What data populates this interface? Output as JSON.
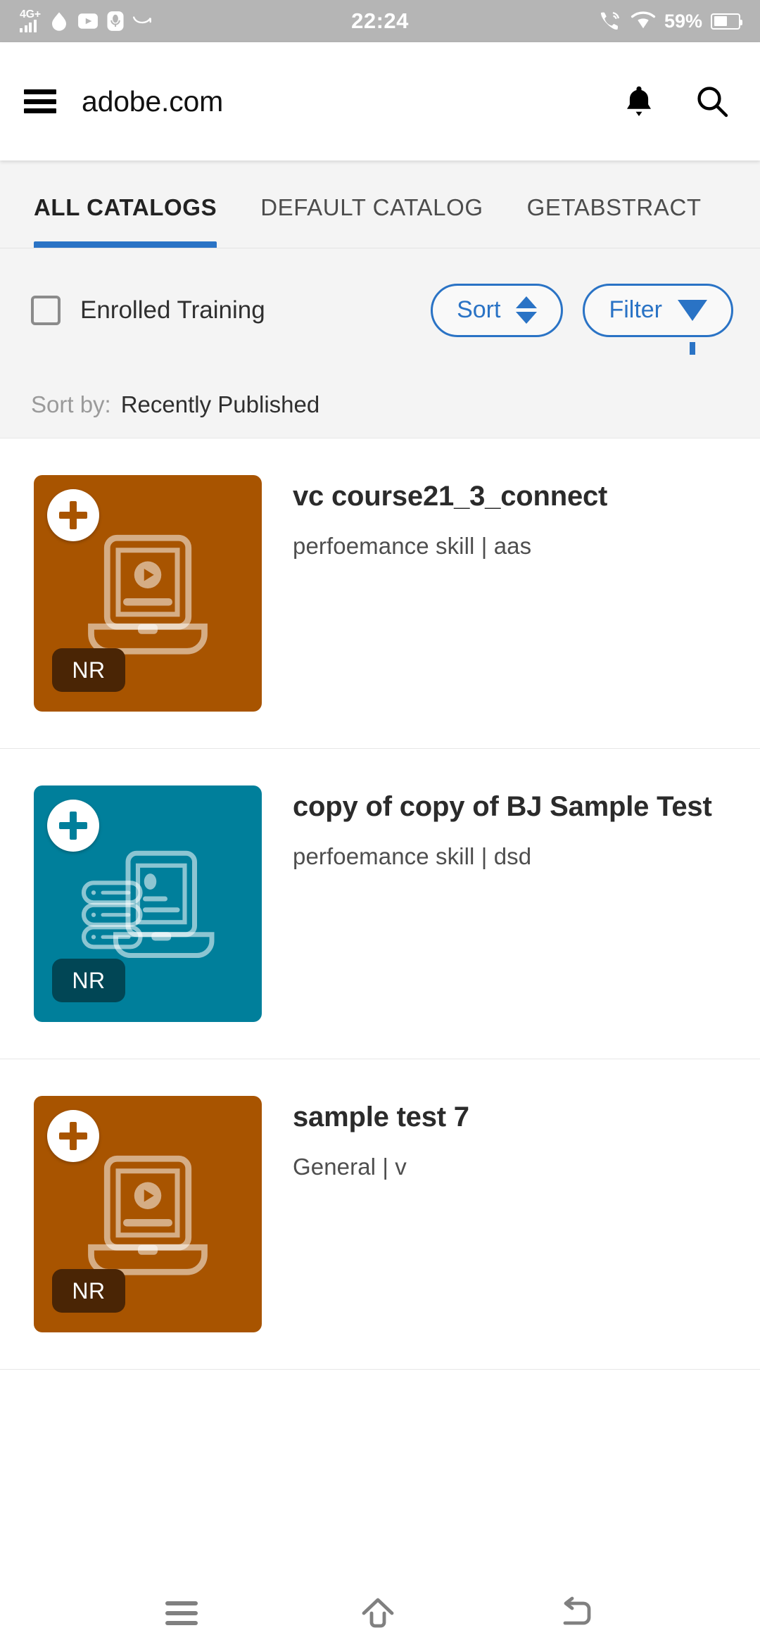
{
  "statusbar": {
    "network_label": "4G+",
    "time": "22:24",
    "battery_percent": "59%",
    "left_icons": [
      "signal-4g-plus-icon",
      "drop-icon",
      "youtube-icon",
      "voice-recorder-icon",
      "arrow-curve-icon"
    ],
    "right_icons": [
      "phone-wifi-calling-icon",
      "wifi-icon",
      "battery-icon"
    ]
  },
  "browser": {
    "menu_icon": "hamburger-menu-icon",
    "url": "adobe.com",
    "notification_icon": "bell-icon",
    "search_icon": "search-icon"
  },
  "tabs": [
    {
      "label": "ALL CATALOGS",
      "active": true
    },
    {
      "label": "DEFAULT CATALOG",
      "active": false
    },
    {
      "label": "GETABSTRACT",
      "active": false
    }
  ],
  "filters": {
    "enrolled_label": "Enrolled Training",
    "enrolled_checked": false,
    "sort_label": "Sort",
    "filter_label": "Filter",
    "sortby_label": "Sort by:",
    "sortby_value": "Recently Published"
  },
  "colors": {
    "accent_blue": "#2a73c5",
    "card_orange": "#a85400",
    "card_teal": "#007f9b",
    "badge_orange_dark": "#4a2505",
    "badge_teal_dark": "#014655"
  },
  "cards": [
    {
      "title": "vc course21_3_connect",
      "subtitle": "perfoemance skill | aas",
      "badge": "NR",
      "add_icon": "plus-icon",
      "thumb_color": "#a85400",
      "badge_color": "#4a2505",
      "art": "laptop-video-icon"
    },
    {
      "title": "copy of copy of BJ Sample Test",
      "subtitle": "perfoemance skill | dsd",
      "badge": "NR",
      "add_icon": "plus-icon",
      "thumb_color": "#007f9b",
      "badge_color": "#014655",
      "art": "books-laptop-icon"
    },
    {
      "title": "sample test 7",
      "subtitle": "General | v",
      "badge": "NR",
      "add_icon": "plus-icon",
      "thumb_color": "#a85400",
      "badge_color": "#4a2505",
      "art": "laptop-video-icon"
    }
  ],
  "navbar": {
    "recents_icon": "recents-icon",
    "home_icon": "home-icon",
    "back_icon": "back-icon"
  }
}
